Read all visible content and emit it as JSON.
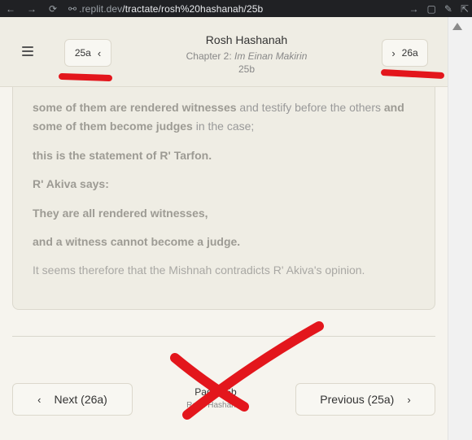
{
  "browser": {
    "url_host": ".replit.dev",
    "url_path": "/tractate/rosh%20hashanah/25b",
    "icons": [
      "back-arrow-icon",
      "forward-arrow-icon",
      "reload-icon",
      "link-icon",
      "arrow-icon",
      "device-icon",
      "extension-icon",
      "share-icon"
    ]
  },
  "header": {
    "prev_label": "25a",
    "next_label": "26a",
    "title": "Rosh Hashanah",
    "chapter_prefix": "Chapter 2: ",
    "chapter_name": "Im Einan Makirin",
    "page": "25b"
  },
  "content": {
    "l1_b1": "some of them are rendered witnesses",
    "l1_n1": " and testify before the others ",
    "l1_b2": "and",
    "l2_b1": "some of them become judges",
    "l2_n1": " in the case;",
    "l3": "this is the statement of R' Tarfon.",
    "l4": "R' Akiva says:",
    "l5": "They are all rendered witnesses,",
    "l6": "and a witness cannot become a judge.",
    "l7": "It seems therefore that the Mishnah contradicts R' Akiva's opinion."
  },
  "footer": {
    "next_button": "Next (26a)",
    "prev_button": "Previous (25a)",
    "page_label": "Page 25b",
    "tractate": "Rosh Hashanah"
  },
  "colors": {
    "annotation_red": "#e3161c",
    "header_bg": "#efede4",
    "page_bg": "#f6f4ee"
  }
}
